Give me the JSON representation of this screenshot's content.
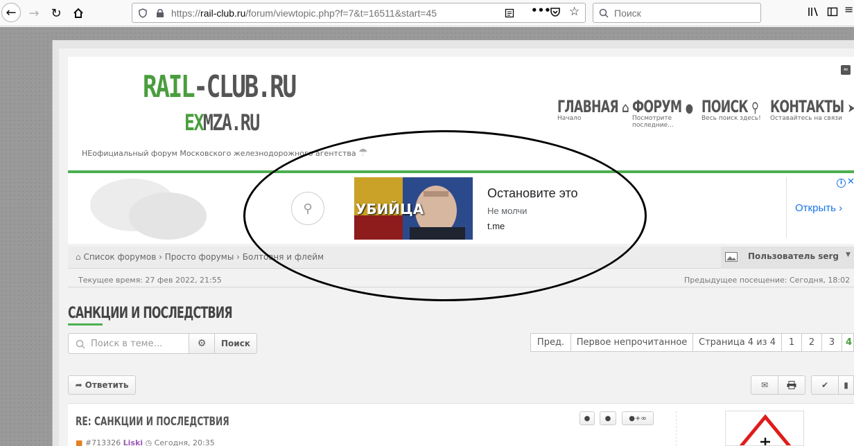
{
  "browser": {
    "url_prefix": "https://",
    "url_host": "rail-club.ru",
    "url_path": "/forum/viewtopic.php?f=7&t=16511&start=45",
    "search_placeholder": "Поиск"
  },
  "header": {
    "logo_rail_green": "RAIL",
    "logo_rail_rest": "-CLUB.RU",
    "logo_ex_green": "EX",
    "logo_ex_rest": "MZA.RU",
    "tagline": "НЕофициальный форум Московского железнодорожного агентства",
    "nav": [
      {
        "label": "ГЛАВНАЯ",
        "sub": "Начало"
      },
      {
        "label": "ФОРУМ",
        "sub": "Посмотрите последние..."
      },
      {
        "label": "ПОИСК",
        "sub": "Весь поиск здесь!"
      },
      {
        "label": "КОНТАКТЫ",
        "sub": "Оставайтесь на связи"
      }
    ]
  },
  "ad": {
    "image_text": "УБИЙЦА",
    "title": "Остановите это",
    "subtitle": "Не молчи",
    "domain": "t.me",
    "cta": "Открыть"
  },
  "breadcrumb": {
    "items": [
      "Список форумов",
      "Просто форумы",
      "Болтовня и флейм"
    ],
    "separator": "›",
    "user_label": "Пользователь serg"
  },
  "time": {
    "current": "Текущее время: 27 фев 2022, 21:55",
    "previous": "Предыдущее посещение: Сегодня, 18:02"
  },
  "topic": {
    "title": "САНКЦИИ И ПОСЛЕДСТВИЯ",
    "search_placeholder": "Поиск в теме…",
    "search_button": "Поиск",
    "reply_button": "Ответить",
    "pagination": {
      "prev": "Пред.",
      "first_unread": "Первое непрочитанное",
      "page_info": "Страница 4 из 4",
      "pages": [
        "1",
        "2",
        "3",
        "4"
      ],
      "current": "4"
    }
  },
  "post": {
    "title": "RE: САНКЦИИ И ПОСЛЕДСТВИЯ",
    "id": "#713326",
    "author": "Liski",
    "time": "Сегодня, 20:35",
    "quote_btn": "+"
  }
}
